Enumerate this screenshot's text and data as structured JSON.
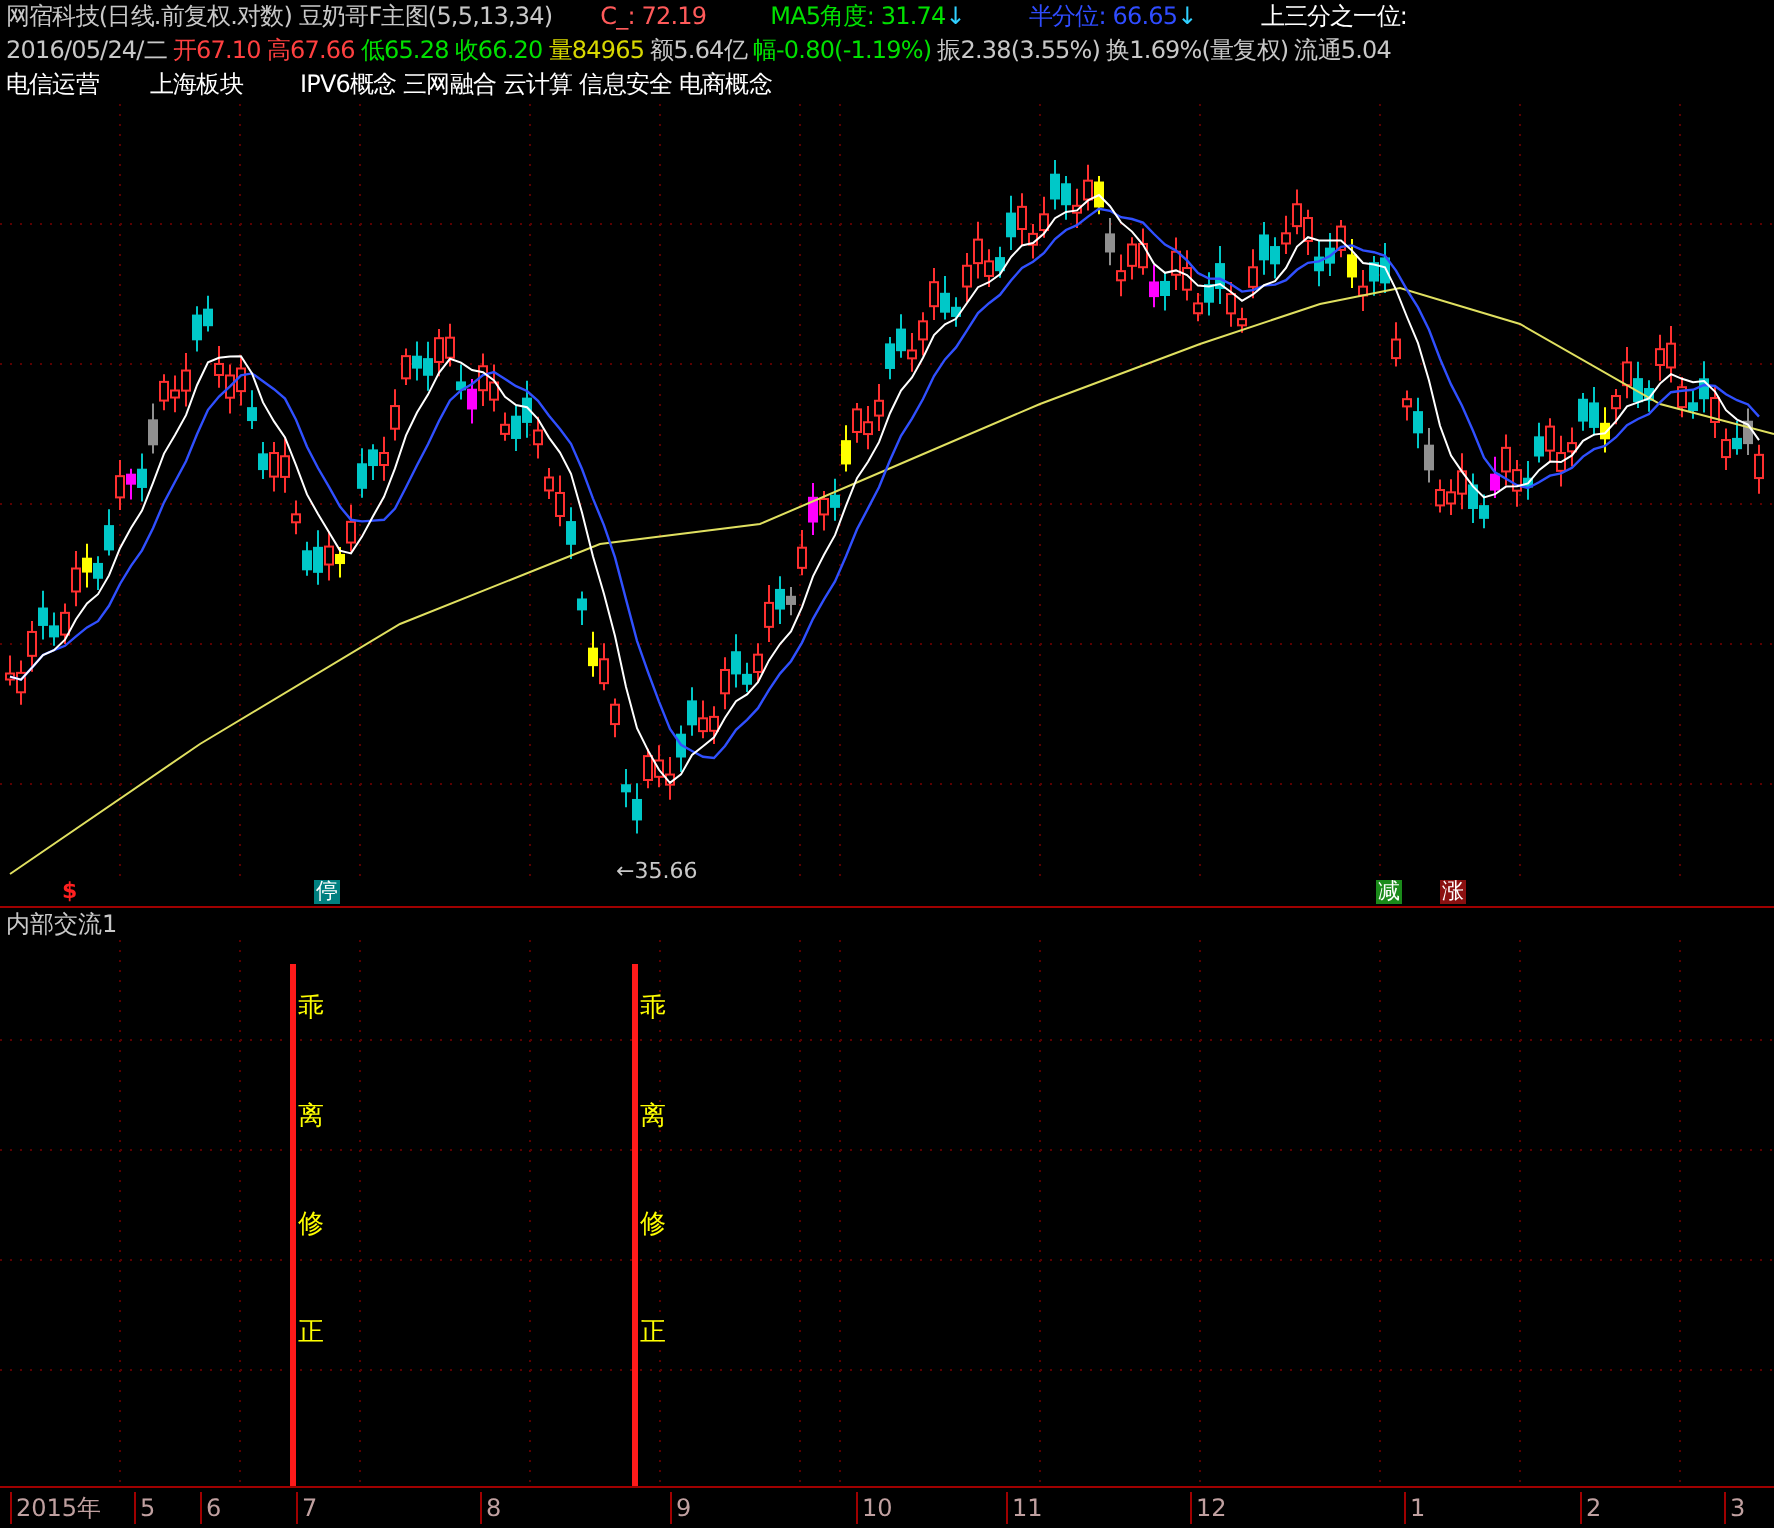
{
  "header": {
    "title": "网宿科技(日线.前复权.对数) 豆奶哥F主图(5,5,13,34)",
    "indicators": [
      {
        "text": "C_: 72.19",
        "color": "#ff5a5a"
      },
      {
        "text": "MA5角度: 31.74",
        "color": "#00e000",
        "arrow": "↓"
      },
      {
        "text": "半分位: 66.65",
        "color": "#2f4cff",
        "arrow": "↓"
      },
      {
        "text": "上三分之一位:",
        "color": "#ffffff"
      }
    ]
  },
  "quote": [
    {
      "text": "2016/05/24/二",
      "color": "#c8c8c8"
    },
    {
      "text": "开67.10",
      "color": "#ff4040"
    },
    {
      "text": "高67.66",
      "color": "#ff4040"
    },
    {
      "text": "低65.28",
      "color": "#00e000"
    },
    {
      "text": "收66.20",
      "color": "#00e000"
    },
    {
      "text": "量84965",
      "color": "#d8d800"
    },
    {
      "text": "额5.64亿",
      "color": "#c8c8c8"
    },
    {
      "text": "幅-0.80(-1.19%)",
      "color": "#00e000"
    },
    {
      "text": "振2.38(3.55%)",
      "color": "#c8c8c8"
    },
    {
      "text": "换1.69%(量复权)",
      "color": "#c8c8c8"
    },
    {
      "text": "流通5.04",
      "color": "#c8c8c8"
    }
  ],
  "concepts": [
    "电信运营",
    "上海板块",
    "IPV6概念 三网融合 云计算 信息安全 电商概念"
  ],
  "chart": {
    "low_label": "←35.66",
    "markers": [
      {
        "text": "$",
        "kind": "text",
        "color": "#ff2020"
      },
      {
        "text": "停",
        "kind": "badge",
        "color": "#008080"
      },
      {
        "text": "减",
        "kind": "badge",
        "color": "#1a8a1a"
      },
      {
        "text": "涨",
        "kind": "badge",
        "color": "#8a1010"
      }
    ]
  },
  "sub_panel": {
    "title": "内部交流1",
    "signals": [
      "乖离修正",
      "乖离修正"
    ]
  },
  "time_axis": [
    "2015年",
    "5",
    "6",
    "7",
    "8",
    "9",
    "10",
    "11",
    "12",
    "1",
    "2",
    "3"
  ]
}
